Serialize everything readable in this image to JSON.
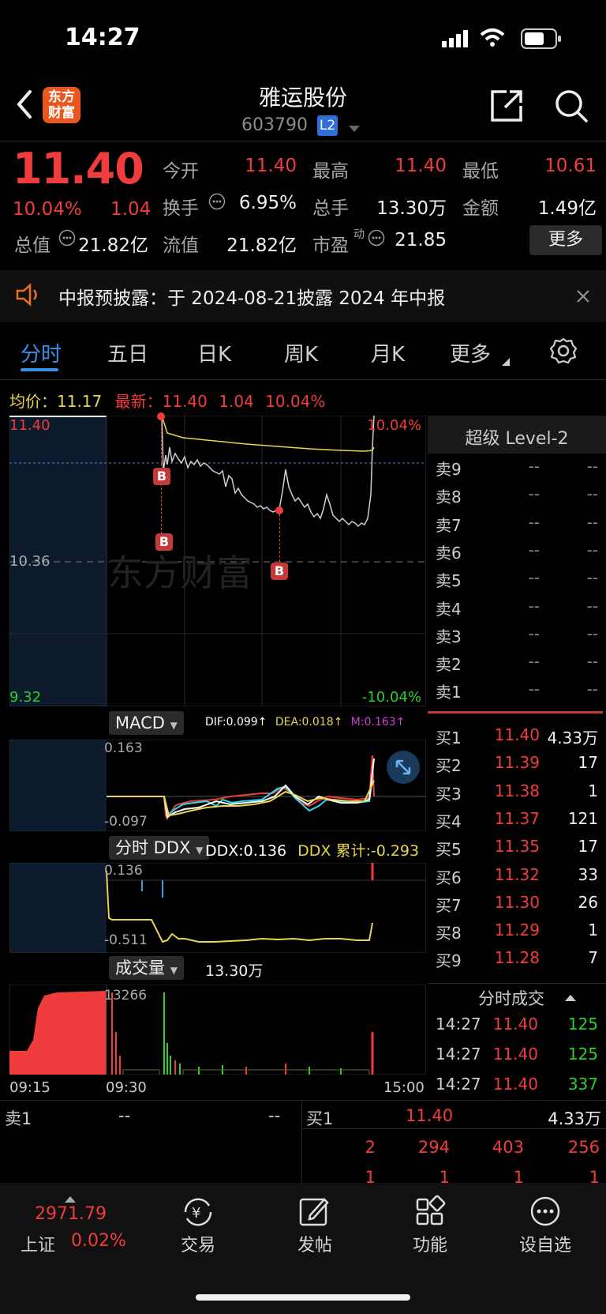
{
  "status": {
    "time": "14:27"
  },
  "header": {
    "title": "雅运股份",
    "code": "603790",
    "level_badge": "L2",
    "logo_text_1": "东方",
    "logo_text_2": "财富"
  },
  "quote": {
    "price": "11.40",
    "change_pct": "10.04%",
    "change": "1.04",
    "open_label": "今开",
    "open": "11.40",
    "high_label": "最高",
    "high": "11.40",
    "low_label": "最低",
    "low": "10.61",
    "turnover_label": "换手",
    "turnover": "6.95%",
    "total_vol_label": "总手",
    "total_vol": "13.30万",
    "amount_label": "金额",
    "amount": "1.49亿",
    "mkt_cap_label": "总值",
    "mkt_cap": "21.82亿",
    "float_cap_label": "流值",
    "float_cap": "21.82亿",
    "pe_label": "市盈",
    "pe_sup": "动",
    "pe": "21.85",
    "more_label": "更多"
  },
  "notice": {
    "text": "中报预披露：于 2024-08-21披露 2024 年中报"
  },
  "tabs": [
    {
      "label": "分时"
    },
    {
      "label": "五日"
    },
    {
      "label": "日K"
    },
    {
      "label": "周K"
    },
    {
      "label": "月K"
    },
    {
      "label": "更多"
    }
  ],
  "info_line": {
    "avg_label": "均价：",
    "avg": "11.17",
    "latest_label": "最新：",
    "latest": "11.40",
    "chg": "1.04",
    "pct": "10.04%"
  },
  "price_chart": {
    "y_top": "11.40",
    "y_mid": "10.36",
    "y_bot": "9.32",
    "pct_top": "10.04%",
    "pct_bot": "-10.04%",
    "watermark": "东方财富",
    "b_marker": "B"
  },
  "macd": {
    "label": "MACD",
    "dif": "DIF:0.099↑",
    "dea": "DEA:0.018↑",
    "m": "M:0.163↑",
    "y_top": "0.163",
    "y_bot": "-0.097"
  },
  "ddx": {
    "label": "分时 DDX",
    "ddx": "DDX:0.136",
    "cum": "DDX 累计:-0.293",
    "y_top": "0.136",
    "y_bot": "-0.511"
  },
  "volume": {
    "label": "成交量",
    "total": "13.30万",
    "y_top": "13266"
  },
  "time_axis": {
    "t1": "09:15",
    "t2": "09:30",
    "t3": "15:00"
  },
  "orderbook": {
    "title": "超级 Level-2",
    "sells": [
      {
        "label": "卖9",
        "price": "--",
        "vol": "--"
      },
      {
        "label": "卖8",
        "price": "--",
        "vol": "--"
      },
      {
        "label": "卖7",
        "price": "--",
        "vol": "--"
      },
      {
        "label": "卖6",
        "price": "--",
        "vol": "--"
      },
      {
        "label": "卖5",
        "price": "--",
        "vol": "--"
      },
      {
        "label": "卖4",
        "price": "--",
        "vol": "--"
      },
      {
        "label": "卖3",
        "price": "--",
        "vol": "--"
      },
      {
        "label": "卖2",
        "price": "--",
        "vol": "--"
      },
      {
        "label": "卖1",
        "price": "--",
        "vol": "--"
      }
    ],
    "buys": [
      {
        "label": "买1",
        "price": "11.40",
        "vol": "4.33万"
      },
      {
        "label": "买2",
        "price": "11.39",
        "vol": "17"
      },
      {
        "label": "买3",
        "price": "11.38",
        "vol": "1"
      },
      {
        "label": "买4",
        "price": "11.37",
        "vol": "121"
      },
      {
        "label": "买5",
        "price": "11.35",
        "vol": "17"
      },
      {
        "label": "买6",
        "price": "11.32",
        "vol": "33"
      },
      {
        "label": "买7",
        "price": "11.30",
        "vol": "26"
      },
      {
        "label": "买8",
        "price": "11.29",
        "vol": "1"
      },
      {
        "label": "买9",
        "price": "11.28",
        "vol": "7"
      }
    ],
    "trades_title": "分时成交",
    "trades": [
      {
        "time": "14:27",
        "price": "11.40",
        "vol": "125"
      },
      {
        "time": "14:27",
        "price": "11.40",
        "vol": "125"
      },
      {
        "time": "14:27",
        "price": "11.40",
        "vol": "337"
      }
    ]
  },
  "queue": {
    "sell_label": "卖1",
    "sell_price": "--",
    "sell_vol": "--",
    "buy_label": "买1",
    "buy_price": "11.40",
    "buy_vol": "4.33万",
    "row1": [
      "2",
      "294",
      "403",
      "256"
    ],
    "row2": [
      "1",
      "1",
      "1",
      "1"
    ]
  },
  "bottom_nav": {
    "index_value": "2971.79",
    "index_name": "上证",
    "index_pct": "0.02%",
    "items": [
      {
        "label": "交易"
      },
      {
        "label": "发帖"
      },
      {
        "label": "功能"
      },
      {
        "label": "设自选"
      }
    ]
  },
  "colors": {
    "up": "#f03c3c",
    "down": "#2ad12a",
    "accent": "#3a8ee6",
    "avg_line": "#e8d44d"
  }
}
